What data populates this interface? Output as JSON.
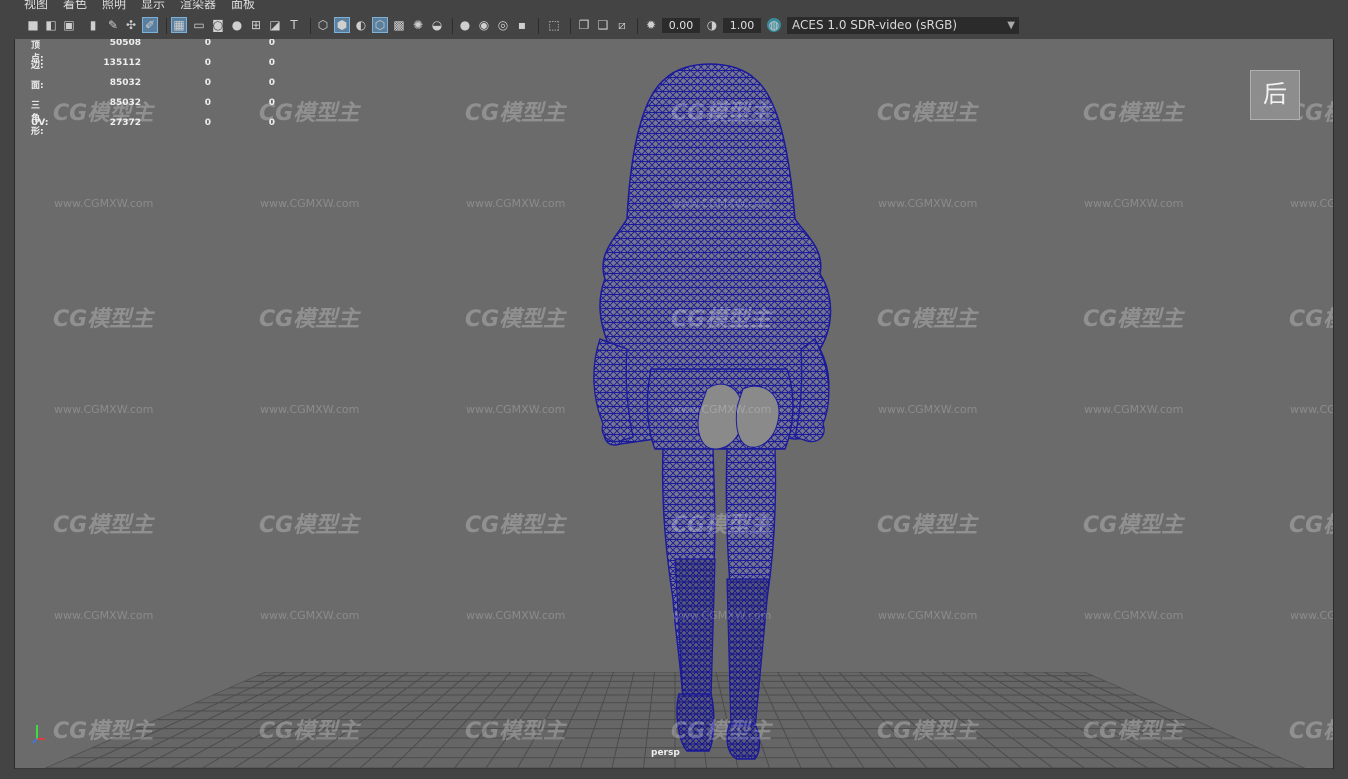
{
  "menu": [
    "视图",
    "着色",
    "照明",
    "显示",
    "渲染器",
    "面板"
  ],
  "toolbar": {
    "field_1": "0.00",
    "field_2": "1.00",
    "color_space": "ACES 1.0 SDR-video (sRGB)"
  },
  "hud": {
    "rows": [
      {
        "label": "顶点:",
        "v1": "50508",
        "v2": "0",
        "v3": "0"
      },
      {
        "label": "边:",
        "v1": "135112",
        "v2": "0",
        "v3": "0"
      },
      {
        "label": "面:",
        "v1": "85032",
        "v2": "0",
        "v3": "0"
      },
      {
        "label": "三角形:",
        "v1": "85032",
        "v2": "0",
        "v3": "0"
      },
      {
        "label": "UV:",
        "v1": "27372",
        "v2": "0",
        "v3": "0"
      }
    ]
  },
  "view_cube_label": "后",
  "camera_label": "persp",
  "watermark": {
    "logo": "CG模型主",
    "url": "www.CGMXW.com"
  },
  "colors": {
    "wireframe": "#1a1a9a",
    "viewport_bg": "#6b6b6b",
    "ui_bg": "#444444"
  }
}
